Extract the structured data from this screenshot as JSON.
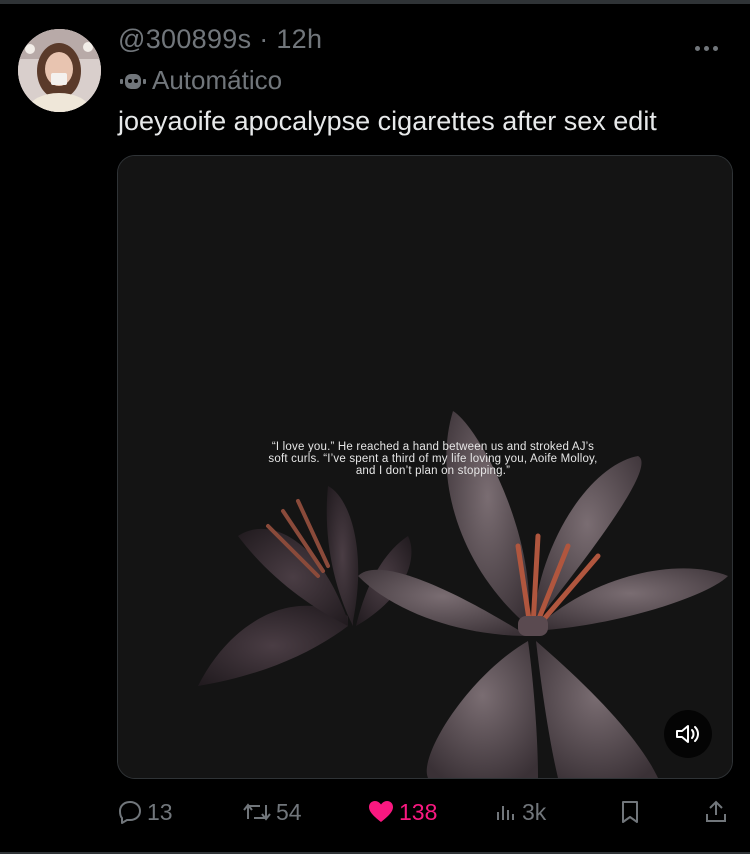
{
  "tweet": {
    "handle": "@300899s",
    "separator": "·",
    "time": "12h",
    "automated_label": "Automático",
    "text": "joeyaoife apocalypse cigarettes after sex edit",
    "media": {
      "caption": "“I love you.” He reached a hand between us and stroked AJ’s soft curls. “I’ve spent a third of my life loving you, Aoife Molloy, and I don’t plan on stopping.”",
      "audio_icon": "speaker-icon"
    },
    "actions": {
      "replies": "13",
      "reposts": "54",
      "likes": "138",
      "views": "3k"
    }
  },
  "colors": {
    "background": "#000000",
    "text_primary": "#e7e9ea",
    "text_secondary": "#71767b",
    "like": "#f91880",
    "divider": "#2f3336"
  },
  "icons": [
    "more-icon",
    "robot-icon",
    "reply-icon",
    "repost-icon",
    "heart-icon",
    "views-icon",
    "bookmark-icon",
    "share-icon"
  ]
}
